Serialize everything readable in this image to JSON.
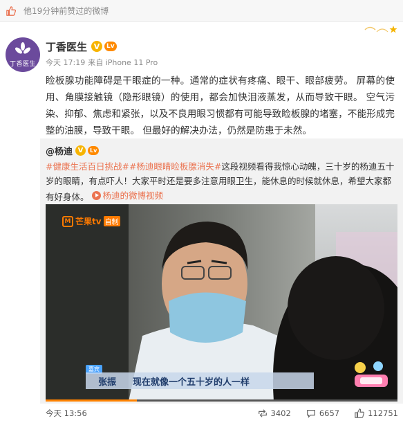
{
  "notice": {
    "text": "他19分钟前赞过的微博",
    "icon": "thumbs-up-icon"
  },
  "post": {
    "author": "丁香医生",
    "avatar_text": "丁香医生",
    "vip_badge": "V",
    "level_badge": "Lv",
    "time": "今天 17:19",
    "source": "来自 iPhone 11 Pro",
    "text": "睑板腺功能障碍是干眼症的一种。通常的症状有疼痛、眼干、眼部疲劳。 屏幕的使用、角膜接触镜（隐形眼镜）的使用，都会加快泪液蒸发，从而导致干眼。 空气污染、抑郁、焦虑和紧张，以及不良用眼习惯都有可能导致睑板腺的堵塞，不能形成完整的油膜，导致干眼。 但最好的解决办法，仍然是防患于未然。"
  },
  "repost": {
    "user": "@杨迪",
    "tags": "#健康生活百日挑战##杨迪眼睛睑板腺消失#",
    "text": "这段视频看得我惊心动魄，三十岁的杨迪五十岁的眼睛，有点吓人！大家平时还是要多注意用眼卫生，能休息的时候就休息，希望大家都有好身体。",
    "video_link": "杨迪的微博视频"
  },
  "video": {
    "channel": "芒果tv",
    "channel_label": "自制",
    "subtitle_badge": "嘉宾",
    "speaker": "张振",
    "subtitle": "现在就像一个五十岁的人一样",
    "progress_percent": 26
  },
  "footer": {
    "time": "今天 13:56",
    "reposts": "3402",
    "comments": "6657",
    "likes": "112751"
  },
  "colors": {
    "accent": "#eb7350",
    "brand": "#ff8200",
    "avatar": "#6b4a9c"
  }
}
